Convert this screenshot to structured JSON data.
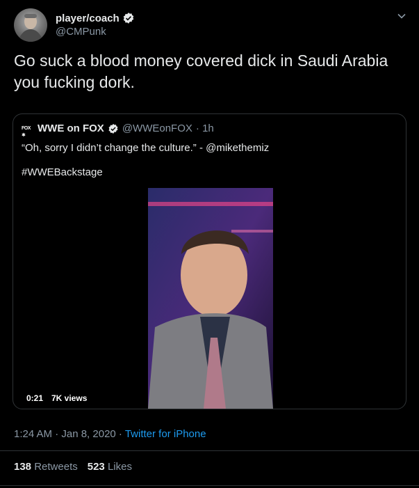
{
  "author": {
    "name": "player/coach",
    "handle": "@CMPunk"
  },
  "tweet_text": "Go suck a blood money covered dick in Saudi Arabia you fucking dork.",
  "quote": {
    "logo_text": "FOX ✱",
    "name": "WWE on FOX",
    "handle": "@WWEonFOX",
    "time": "· 1h",
    "text": "“Oh, sorry I didn’t change the culture.” - @mikethemiz",
    "hashtag": "#WWEBackstage",
    "video": {
      "duration": "0:21",
      "views": "7K views"
    }
  },
  "meta": {
    "timestamp": "1:24 AM · Jan 8, 2020 ·",
    "source": "Twitter for iPhone"
  },
  "stats": {
    "retweets_count": "138",
    "retweets_label": "Retweets",
    "likes_count": "523",
    "likes_label": "Likes"
  },
  "colors": {
    "background": "#000000",
    "accent": "#1d9bf0",
    "secondary_text": "#8b98a5",
    "border": "#2f3336"
  },
  "icons": [
    "verified-badge-icon",
    "chevron-down-icon"
  ]
}
